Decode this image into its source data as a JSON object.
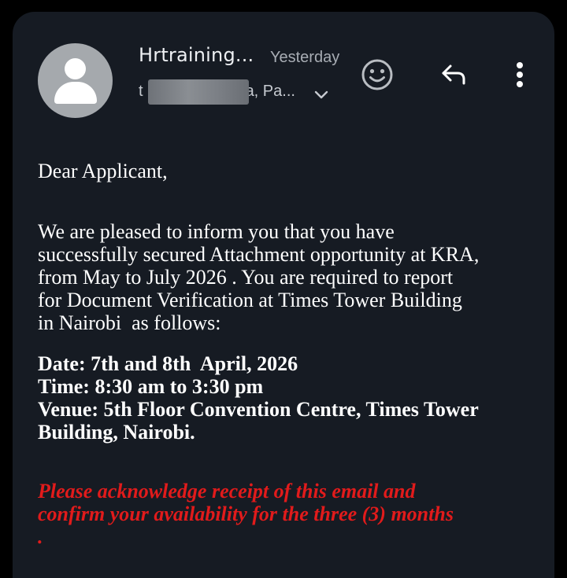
{
  "email": {
    "sender": "Hrtraining...",
    "time": "Yesterday",
    "recipients_start": "t",
    "recipients_end": "a, Pa...",
    "actions": {
      "emoji_icon": "smiley-face-icon",
      "reply_icon": "reply-arrow-icon",
      "more_icon": "more-vertical-icon",
      "expand_icon": "chevron-down-icon"
    },
    "greeting": "Dear Applicant,",
    "paragraph_lines": [
      "We are pleased to inform you that you have",
      "successfully secured Attachment opportunity at KRA,",
      "from May to July 2026 . You are required to report",
      "for Document Verification at Times Tower Building",
      "in Nairobi  as follows:"
    ],
    "details_lines": [
      "Date: 7th and 8th  April, 2026",
      "Time: 8:30 am to 3:30 pm",
      "Venue: 5th Floor Convention Centre, Times Tower",
      "Building, Nairobi."
    ],
    "notice_lines": [
      "Please acknowledge receipt of this email and",
      "confirm your availability for the three (3) months",
      "."
    ]
  },
  "colors": {
    "card_background": "#161b23",
    "notice_red": "#e11b1b",
    "avatar_gray": "#a5a9ad"
  }
}
